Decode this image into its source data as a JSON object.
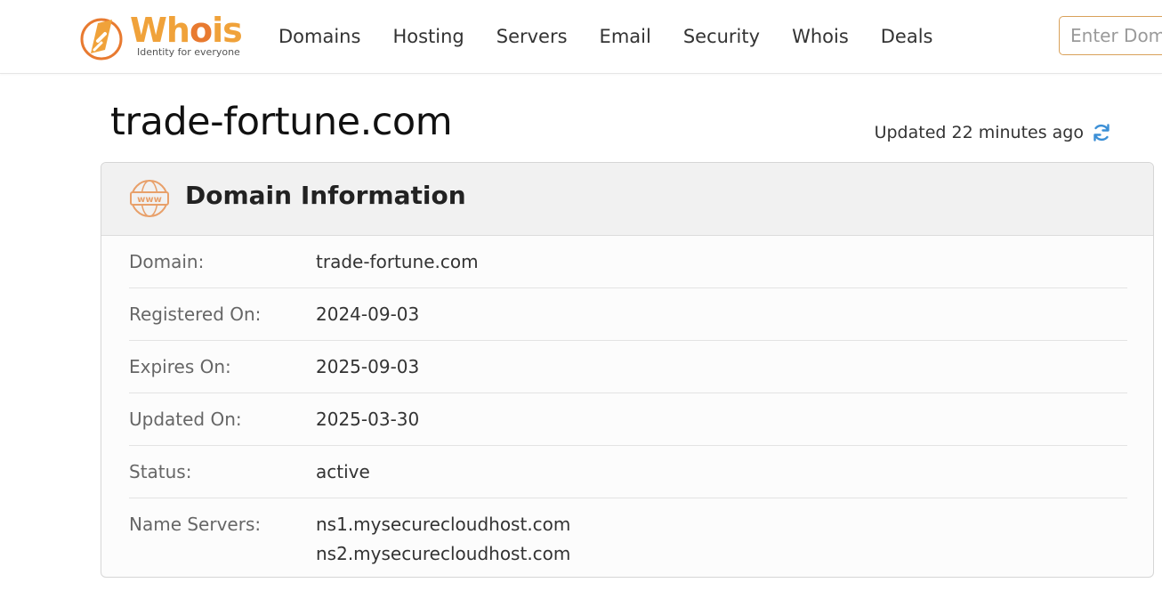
{
  "header": {
    "logo": {
      "word_main": "Wh",
      "word_o": "o",
      "word_end": "is",
      "tagline": "Identity for everyone",
      "icon": "whois-logo-mark-icon",
      "colors": {
        "primary": "#f0a23a",
        "secondary": "#e87a30"
      }
    },
    "nav": [
      {
        "label": "Domains"
      },
      {
        "label": "Hosting"
      },
      {
        "label": "Servers"
      },
      {
        "label": "Email"
      },
      {
        "label": "Security"
      },
      {
        "label": "Whois"
      },
      {
        "label": "Deals"
      }
    ],
    "search": {
      "placeholder": "Enter Domain",
      "value": ""
    }
  },
  "page": {
    "title": "trade-fortune.com",
    "updated_text": "Updated 22 minutes ago",
    "refresh_icon": "refresh-icon",
    "accent_color": "#3b8fd6"
  },
  "domain_info": {
    "title": "Domain Information",
    "icon": "www-icon",
    "rows": [
      {
        "label": "Domain:",
        "value": "trade-fortune.com"
      },
      {
        "label": "Registered On:",
        "value": "2024-09-03"
      },
      {
        "label": "Expires On:",
        "value": "2025-09-03"
      },
      {
        "label": "Updated On:",
        "value": "2025-03-30"
      },
      {
        "label": "Status:",
        "value": "active"
      }
    ],
    "name_servers": {
      "label": "Name Servers:",
      "values": [
        "ns1.mysecurecloudhost.com",
        "ns2.mysecurecloudhost.com"
      ]
    }
  }
}
